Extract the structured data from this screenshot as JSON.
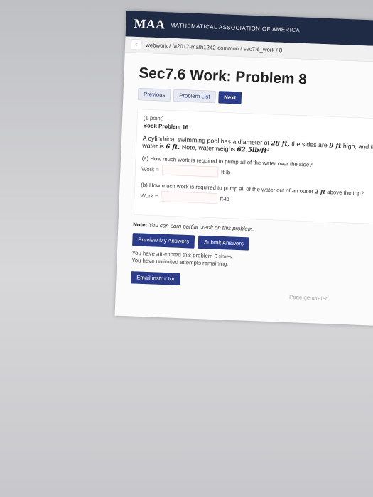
{
  "header": {
    "logo": "MAA",
    "org": "MATHEMATICAL ASSOCIATION OF AMERICA"
  },
  "breadcrumb": "webwork / fa2017-math1242-common / sec7.6_work / 8",
  "page_title": "Sec7.6 Work: Problem 8",
  "nav": {
    "previous": "Previous",
    "problem_list": "Problem List",
    "next": "Next"
  },
  "problem": {
    "points": "(1 point)",
    "book": "Book Problem 16",
    "statement_pre": "A cylindrical swimming pool has a diameter of",
    "diameter": "28 ft,",
    "statement_mid1": "the sides are",
    "sides": "9 ft",
    "statement_mid2": "high, and the depth of the water is",
    "depth": "6 ft.",
    "statement_mid3": "Note, water weighs",
    "weight": "62.5lb/ft³",
    "part_a": "(a) How much work is required to pump all of the water over the side?",
    "part_b_pre": "(b) How much work is required to pump all of the water out of an outlet",
    "outlet": "2 ft",
    "part_b_post": "above the top?",
    "work_label": "Work =",
    "unit": "ft-lb"
  },
  "note": {
    "label": "Note:",
    "text": "You can earn partial credit on this problem."
  },
  "buttons": {
    "preview": "Preview My Answers",
    "submit": "Submit Answers",
    "email": "Email instructor"
  },
  "attempts": {
    "line1": "You have attempted this problem 0 times.",
    "line2": "You have unlimited attempts remaining."
  },
  "footer": "Page generated"
}
